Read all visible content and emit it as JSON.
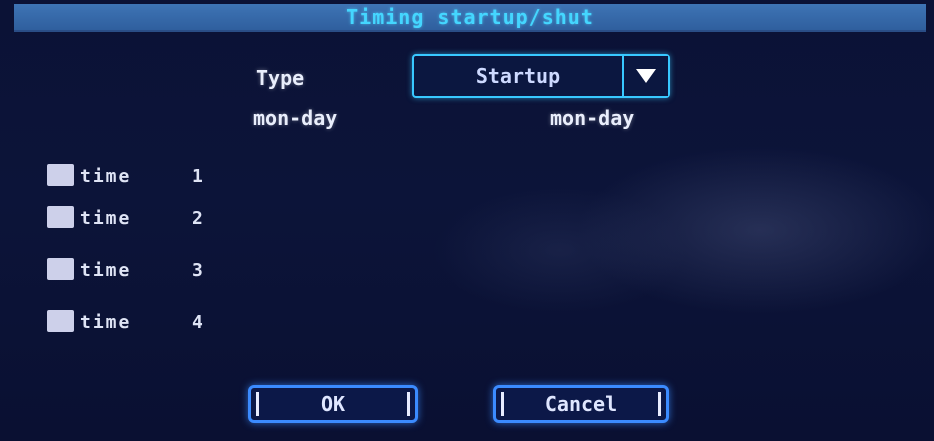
{
  "title": "Timing startup/shut",
  "type_row": {
    "label": "Type",
    "select_value": "Startup"
  },
  "columns": {
    "left_header": "mon-day",
    "right_header": "mon-day"
  },
  "times": [
    {
      "label": "time",
      "number": "1",
      "checked": false
    },
    {
      "label": "time",
      "number": "2",
      "checked": false
    },
    {
      "label": "time",
      "number": "3",
      "checked": false
    },
    {
      "label": "time",
      "number": "4",
      "checked": false
    }
  ],
  "buttons": {
    "ok": "OK",
    "cancel": "Cancel"
  },
  "colors": {
    "title_bar": "#3e74b5",
    "title_text": "#44d6ff",
    "accent": "#38c8ff",
    "background": "#0b1236"
  },
  "icons": {
    "dropdown": "triangle-down-icon"
  }
}
